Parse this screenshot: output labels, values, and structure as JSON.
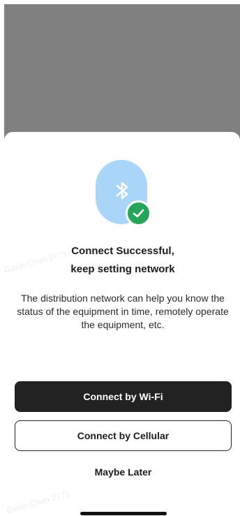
{
  "colors": {
    "backdrop": "#808080",
    "sheet": "#ffffff",
    "icon_bg": "#a9d6f8",
    "success_badge": "#25a559",
    "primary_button": "#222222"
  },
  "icons": {
    "bluetooth": "bluetooth-icon",
    "success": "check-circle-icon"
  },
  "dialog": {
    "title_line1": "Connect Successful,",
    "title_line2": "keep setting network",
    "description": "The distribution network can help you know the status of the equipment in time, remotely operate the equipment, etc."
  },
  "actions": {
    "wifi_label": "Connect by Wi-Fi",
    "cellular_label": "Connect by Cellular",
    "later_label": "Maybe Later"
  },
  "watermark": {
    "text": "Gavin.Chen 2771"
  }
}
